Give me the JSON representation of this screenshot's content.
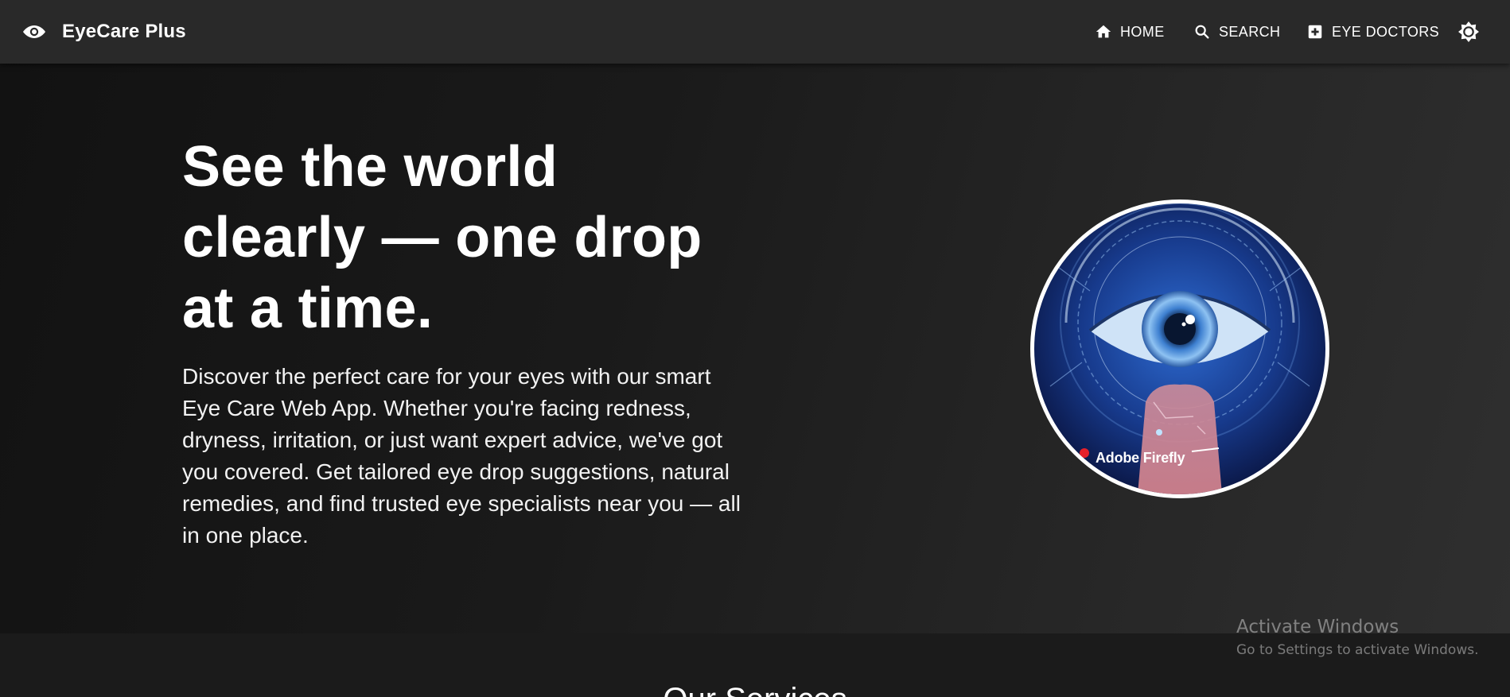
{
  "navbar": {
    "brand_title": "EyeCare Plus",
    "brand_icon": "eye-icon",
    "links": [
      {
        "label": "HOME",
        "icon": "home-icon"
      },
      {
        "label": "SEARCH",
        "icon": "search-icon"
      },
      {
        "label": "EYE DOCTORS",
        "icon": "medical-plus-icon"
      }
    ],
    "theme_toggle_icon": "brightness-icon"
  },
  "hero": {
    "headline": "See the world clearly — one drop at a time.",
    "intro": "Discover the perfect care for your eyes with our smart Eye Care Web App. Whether you're facing redness, dryness, irritation, or just want expert advice, we've got you covered. Get tailored eye drop suggestions, natural remedies, and find trusted eye specialists near you — all in one place.",
    "image_caption": "Adobe Firefly"
  },
  "services": {
    "title": "Our Services"
  },
  "system_overlay": {
    "title": "Activate Windows",
    "subtitle": "Go to Settings to activate Windows."
  },
  "colors": {
    "navbar_bg": "#292929",
    "page_bg": "#1b1b1b",
    "text": "#ffffff",
    "image_border": "#ffffff"
  }
}
